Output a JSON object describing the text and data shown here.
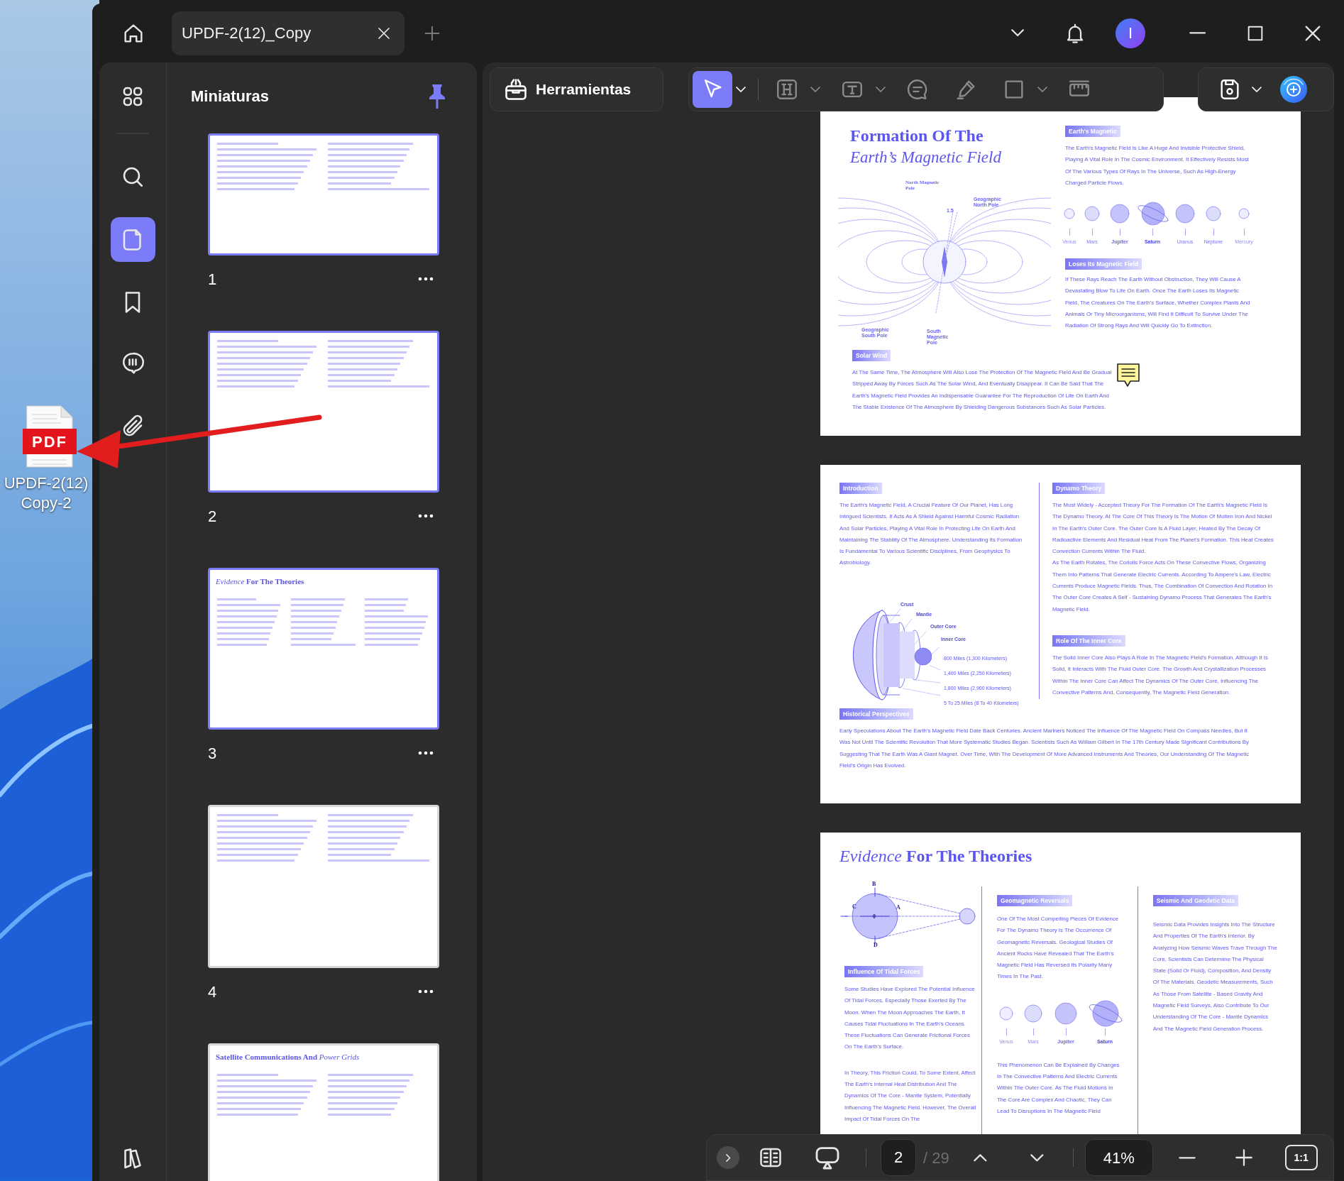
{
  "desktop": {
    "icon": {
      "badge": "PDF",
      "label": "UPDF-2(12) Copy-2"
    }
  },
  "titlebar": {
    "tabs": [
      {
        "title": "UPDF-2(12)_Copy",
        "selected": true
      }
    ],
    "avatar": "I"
  },
  "rail": [
    {
      "kind": "apps",
      "selected": false
    },
    {
      "kind": "search",
      "selected": false
    },
    {
      "kind": "thumbnails",
      "selected": true
    },
    {
      "kind": "bookmarks",
      "selected": false
    },
    {
      "kind": "comments",
      "selected": false
    },
    {
      "kind": "attachments",
      "selected": false
    }
  ],
  "thumbnails": {
    "title": "Miniaturas",
    "pinned": true,
    "pages": [
      {
        "number": "1",
        "highlighted": true,
        "kind": "cover"
      },
      {
        "number": "2",
        "highlighted": true,
        "kind": "two-column"
      },
      {
        "number": "3",
        "highlighted": true,
        "kind": "three-column",
        "title": "*Evidence* **For The Theories**"
      },
      {
        "number": "4",
        "highlighted": false,
        "kind": "two-column"
      },
      {
        "highlighted": false,
        "kind": "table",
        "title": "**Satellite Communications And** *Power Grids*"
      }
    ]
  },
  "toolbar": {
    "tools_label": "Herramientas",
    "tools": [
      {
        "kind": "select",
        "selected": true,
        "dropdown": true
      },
      {
        "kind": "heading",
        "selected": false,
        "dropdown": true
      },
      {
        "kind": "text",
        "selected": false,
        "dropdown": true
      },
      {
        "kind": "comment",
        "selected": false,
        "dropdown": false
      },
      {
        "kind": "pen",
        "selected": false,
        "dropdown": false
      },
      {
        "kind": "shape",
        "selected": false,
        "dropdown": true
      },
      {
        "kind": "measure",
        "selected": false,
        "dropdown": false
      }
    ]
  },
  "pages": [
    {
      "kind": "cover",
      "title": "Formation Of The",
      "subtitle": "Earth’s Magnetic Field",
      "diagram_labels": [
        "North Magnetic Pole",
        "Geographic North Pole",
        "1.5",
        "Geographic South Pole",
        "South Magnetic Pole"
      ],
      "intro": {
        "heading": "Earth's Magnetic",
        "text": "The Earth's Magnetic Field Is Like A Huge And Invisible Protective Shield, Playing A Vital Role In The Cosmic Environment. It Effectively Resists Most Of The Various Types Of Rays In The Universe, Such As High-Energy Charged Particle Flows."
      },
      "planets": [
        "Venus",
        "Mars",
        "Jupiter",
        "Saturn",
        "Uranus",
        "Neptune",
        "Mercury"
      ],
      "field_loss": {
        "heading": "Loses Its Magnetic Field",
        "text": "If These Rays Reach The Earth Without Obstruction, They Will Cause A Devastating Blow To Life On Earth. Once The Earth Loses Its Magnetic Field, The Creatures On The Earth's Surface, Whether Complex Plants And Animals Or Tiny Microorganisms, Will Find It Difficult To Survive Under The Radiation Of Strong Rays And Will Quickly Go To Extinction."
      },
      "solar_wind": {
        "heading": "Solar Wind",
        "text": "At The Same Time, The Atmosphere Will Also Lose The Protection Of The Magnetic Field And Be Gradual Stripped Away By Forces Such As The Solar Wind, And Eventually Disappear. It Can Be Said That The Earth's Magnetic Field Provides An Indispensable Guarantee For The Reproduction Of Life On Earth And The Stable Existence Of The Atmosphere By Shielding Dangerous Substances Such As Solar Particles."
      }
    },
    {
      "kind": "two-column",
      "introduction": {
        "heading": "Introduction",
        "text": "The Earth's Magnetic Field, A Crucial Feature Of Our Planet, Has Long Intrigued Scientists. It Acts As A Shield Against Harmful Cosmic Radiation And Solar Particles, Playing A Vital Role In Protecting Life On Earth And Maintaining The Stability Of The Atmosphere. Understanding Its Formation Is Fundamental To Various Scientific Disciplines, From Geophysics To Astrobiology."
      },
      "layer_labels": [
        "Crust",
        "Mantle",
        "Outer Core",
        "Inner Core"
      ],
      "distances": [
        "800 Miles (1,300 Kilometers)",
        "1,400 Miles (2,250 Kilometers)",
        "1,800 Miles (2,900 Kilometers)",
        "5 To 25 Miles (8 To 40 Kilometers)"
      ],
      "dynamo": {
        "heading": "Dynamo Theory",
        "paragraphs": [
          "The Most Widely - Accepted Theory For The Formation Of The Earth's Magnetic Field Is The Dynamo Theory. At The Core Of This Theory Is The Motion Of Molten Iron And Nickel In The Earth's Outer Core. The Outer Core Is A Fluid Layer, Heated By The Decay Of Radioactive Elements And Residual Heat From The Planet's Formation. This Heat Creates Convection Currents Within The Fluid.",
          "As The Earth Rotates, The Coriolis Force Acts On These Convective Flows, Organizing Them Into Patterns That Generate Electric Currents. According To Ampere's Law, Electric Currents Produce Magnetic Fields. Thus, The Combination Of Convection And Rotation In The Outer Core Creates A Self - Sustaining Dynamo Process That Generates The Earth's Magnetic Field."
        ]
      },
      "inner_core": {
        "heading": "Role Of The Inner Core",
        "text": "The Solid Inner Core Also Plays A Role In The Magnetic Field's Formation. Although It Is Solid, It Interacts With The Fluid Outer Core. The Growth And Crystallization Processes Within The Inner Core Can Affect The Dynamics Of The Outer Core, Influencing The Convective Patterns And, Consequently, The Magnetic Field Generation."
      },
      "history": {
        "heading": "Historical Perspectives",
        "text": "Early Speculations About The Earth's Magnetic Field Date Back Centuries. Ancient Mariners Noticed The Influence Of The Magnetic Field On Compass Needles, But It Was Not Until The Scientific Revolution That More Systematic Studies Began. Scientists Such As William Gilbert In The 17th Century Made Significant Contributions By Suggesting That The Earth Was A Giant Magnet. Over Time, With The Development Of More Advanced Instruments And Theories, Our Understanding Of The Magnetic Field's Origin Has Evolved."
      }
    },
    {
      "kind": "three-column",
      "title": "*Evidence* **For The Theories**",
      "diagram_labels": [
        "B",
        "C",
        "0",
        "A",
        "D"
      ],
      "tidal": {
        "heading": "Influence Of Tidal Forces",
        "paragraphs": [
          "Some Studies Have Explored The Potential Influence Of Tidal Forces, Especially Those Exerted By The Moon. When The Moon Approaches The Earth, It Causes Tidal Fluctuations In The Earth's Oceans. These Fluctuations Can Generate Frictional Forces On The Earth's Surface.",
          "In Theory, This Friction Could, To Some Extent, Affect The Earth's Internal Heat Distribution And The Dynamics Of The Core - Mantle System, Potentially Influencing The Magnetic Field. However, The Overall Impact Of Tidal Forces On The"
        ]
      },
      "reversals": {
        "heading": "Geomagnetic Reversals",
        "text": "One Of The Most Compelling Pieces Of Evidence For The Dynamo Theory Is The Occurrence Of Geomagnetic Reversals. Geological Studies Of Ancient Rocks Have Revealed That The Earth's Magnetic Field Has Reversed Its Polarity Many Times In The Past.",
        "planets": [
          "Venus",
          "Mars",
          "Jupiter",
          "Saturn"
        ],
        "text2": "This Phenomenon Can Be Explained By Changes In The Convective Patterns And Electric Currents Within The Outer Core. As The Fluid Motions In The Core Are Complex And Chaotic, They Can Lead To Disruptions In The Magnetic Field"
      },
      "seismic": {
        "heading": "Seismic And Geodetic Data",
        "text": "Seismic Data Provides Insights Into The Structure And Properties Of The Earth's Interior. By Analyzing How Seismic Waves Trave Through The Core, Scientists Can Determine The Physical State (Solid Or Fluid), Composition, And Density Of The Materials. Geodetic Measurements, Such As Those From Satellite - Based Gravity And Magnetic Field Surveys, Also Contribute To Our Understanding Of The Core - Mantle Dynamics And The Magnetic Field Generation Process."
      }
    }
  ],
  "bottom_bar": {
    "page": "2",
    "total": "/ 29",
    "zoom": "41%",
    "actual_size": "1:1"
  }
}
